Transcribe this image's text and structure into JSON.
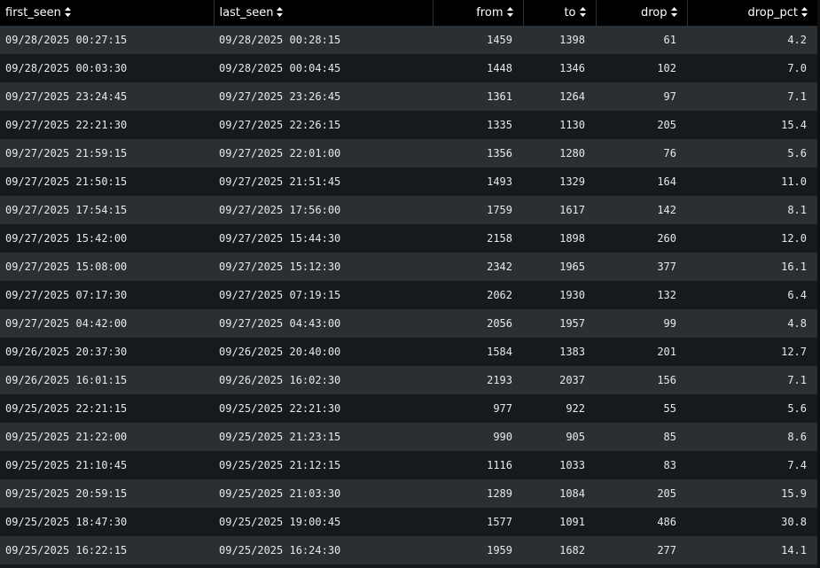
{
  "table": {
    "columns": [
      {
        "key": "first_seen",
        "label": "first_seen"
      },
      {
        "key": "last_seen",
        "label": "last_seen"
      },
      {
        "key": "from",
        "label": "from"
      },
      {
        "key": "to",
        "label": "to"
      },
      {
        "key": "drop",
        "label": "drop"
      },
      {
        "key": "drop_pct",
        "label": "drop_pct"
      }
    ],
    "sort_icon": "sort-up-down-icon",
    "rows": [
      [
        "09/28/2025 00:27:15",
        "09/28/2025 00:28:15",
        "1459",
        "1398",
        "61",
        "4.2"
      ],
      [
        "09/28/2025 00:03:30",
        "09/28/2025 00:04:45",
        "1448",
        "1346",
        "102",
        "7.0"
      ],
      [
        "09/27/2025 23:24:45",
        "09/27/2025 23:26:45",
        "1361",
        "1264",
        "97",
        "7.1"
      ],
      [
        "09/27/2025 22:21:30",
        "09/27/2025 22:26:15",
        "1335",
        "1130",
        "205",
        "15.4"
      ],
      [
        "09/27/2025 21:59:15",
        "09/27/2025 22:01:00",
        "1356",
        "1280",
        "76",
        "5.6"
      ],
      [
        "09/27/2025 21:50:15",
        "09/27/2025 21:51:45",
        "1493",
        "1329",
        "164",
        "11.0"
      ],
      [
        "09/27/2025 17:54:15",
        "09/27/2025 17:56:00",
        "1759",
        "1617",
        "142",
        "8.1"
      ],
      [
        "09/27/2025 15:42:00",
        "09/27/2025 15:44:30",
        "2158",
        "1898",
        "260",
        "12.0"
      ],
      [
        "09/27/2025 15:08:00",
        "09/27/2025 15:12:30",
        "2342",
        "1965",
        "377",
        "16.1"
      ],
      [
        "09/27/2025 07:17:30",
        "09/27/2025 07:19:15",
        "2062",
        "1930",
        "132",
        "6.4"
      ],
      [
        "09/27/2025 04:42:00",
        "09/27/2025 04:43:00",
        "2056",
        "1957",
        "99",
        "4.8"
      ],
      [
        "09/26/2025 20:37:30",
        "09/26/2025 20:40:00",
        "1584",
        "1383",
        "201",
        "12.7"
      ],
      [
        "09/26/2025 16:01:15",
        "09/26/2025 16:02:30",
        "2193",
        "2037",
        "156",
        "7.1"
      ],
      [
        "09/25/2025 22:21:15",
        "09/25/2025 22:21:30",
        "977",
        "922",
        "55",
        "5.6"
      ],
      [
        "09/25/2025 21:22:00",
        "09/25/2025 21:23:15",
        "990",
        "905",
        "85",
        "8.6"
      ],
      [
        "09/25/2025 21:10:45",
        "09/25/2025 21:12:15",
        "1116",
        "1033",
        "83",
        "7.4"
      ],
      [
        "09/25/2025 20:59:15",
        "09/25/2025 21:03:30",
        "1289",
        "1084",
        "205",
        "15.9"
      ],
      [
        "09/25/2025 18:47:30",
        "09/25/2025 19:00:45",
        "1577",
        "1091",
        "486",
        "30.8"
      ],
      [
        "09/25/2025 16:22:15",
        "09/25/2025 16:24:30",
        "1959",
        "1682",
        "277",
        "14.1"
      ]
    ]
  },
  "colors": {
    "header_bg": "#000000",
    "row_odd": "#2a2f33",
    "row_even": "#171a1d",
    "text": "#e8e8e8"
  }
}
